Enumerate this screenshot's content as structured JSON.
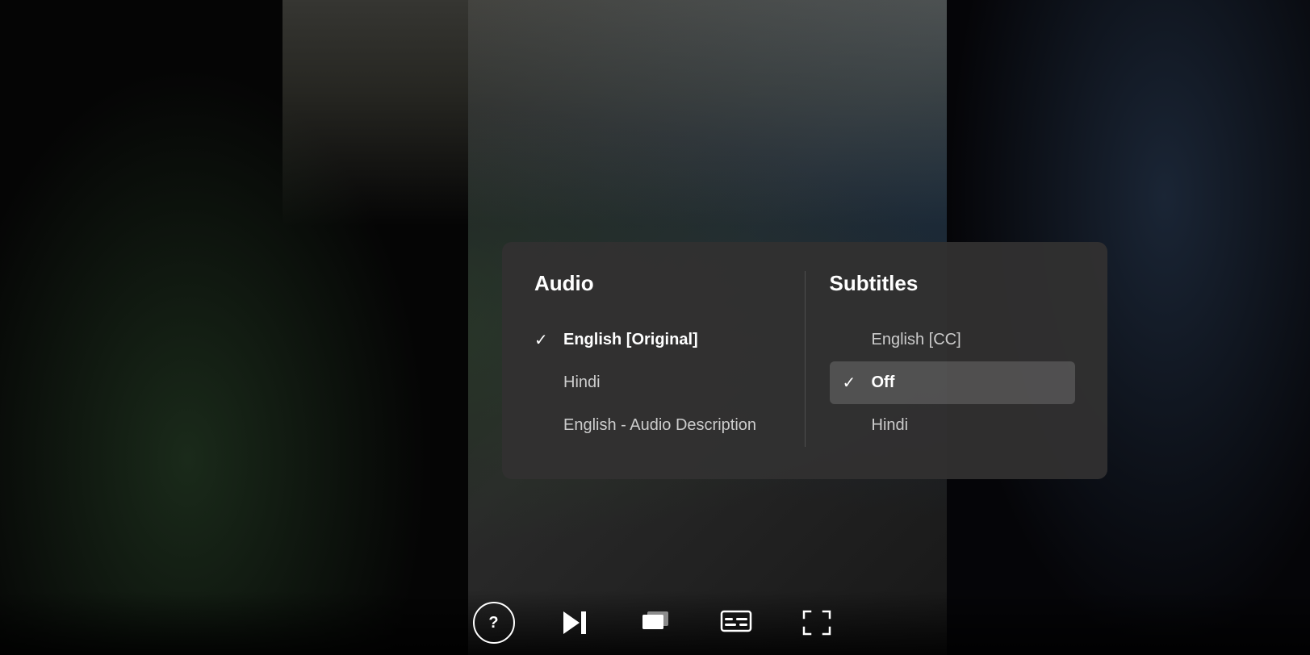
{
  "background": {
    "description": "Dark video player background with film scene"
  },
  "panel": {
    "audio": {
      "header": "Audio",
      "items": [
        {
          "id": "english-original",
          "label": "English [Original]",
          "selected": true
        },
        {
          "id": "hindi",
          "label": "Hindi",
          "selected": false
        },
        {
          "id": "english-ad",
          "label": "English - Audio Description",
          "selected": false
        }
      ]
    },
    "subtitles": {
      "header": "Subtitles",
      "items": [
        {
          "id": "english-cc",
          "label": "English [CC]",
          "selected": false
        },
        {
          "id": "off",
          "label": "Off",
          "selected": true
        },
        {
          "id": "hindi",
          "label": "Hindi",
          "selected": false
        }
      ]
    }
  },
  "controls": {
    "help_label": "?",
    "buttons": [
      {
        "id": "help",
        "label": "?"
      },
      {
        "id": "skip-forward",
        "label": "⏭"
      },
      {
        "id": "episodes",
        "label": "episodes"
      },
      {
        "id": "subtitles",
        "label": "subtitles"
      },
      {
        "id": "fullscreen",
        "label": "fullscreen"
      }
    ]
  }
}
